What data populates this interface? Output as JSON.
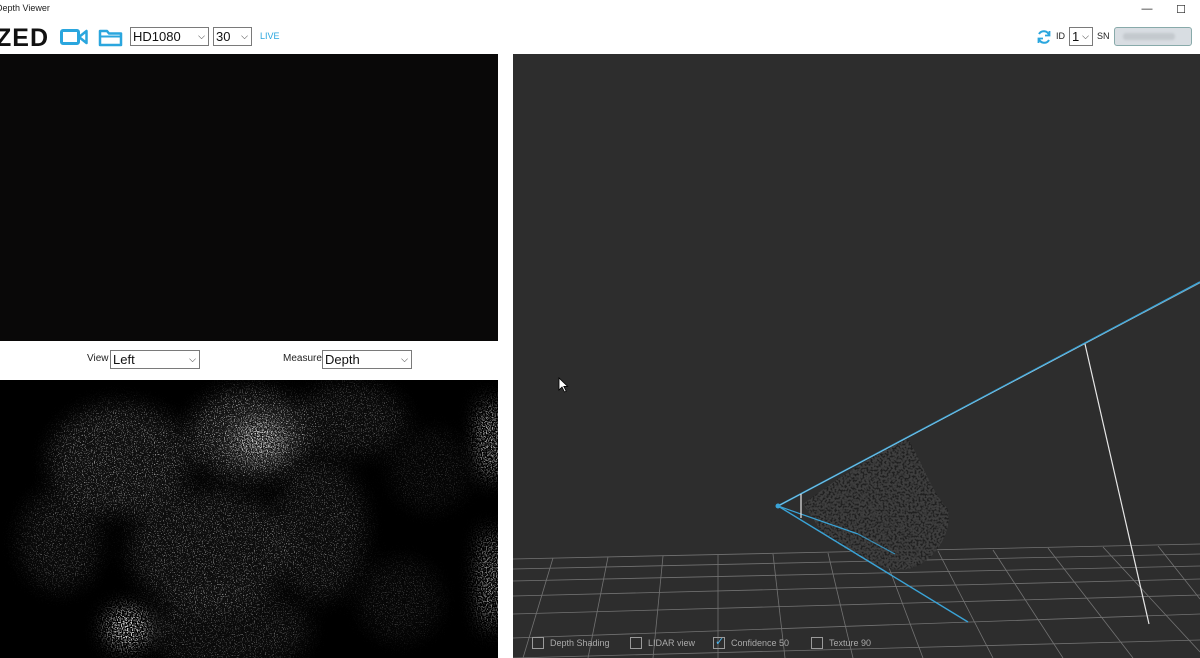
{
  "window": {
    "title": "Depth Viewer",
    "minimize_glyph": "—",
    "maximize_glyph": "☐"
  },
  "toolbar": {
    "logo": "ZED",
    "camera_icon": "video-camera-icon",
    "folder_icon": "folder-icon",
    "resolution": "HD1080",
    "fps": "30",
    "status": "LIVE",
    "refresh_icon": "refresh-icon",
    "id_label": "ID",
    "id_value": "1",
    "sn_label": "SN",
    "sn_value": ""
  },
  "left_panel": {
    "view_label": "View",
    "view_value": "Left",
    "measure_label": "Measure",
    "measure_value": "Depth"
  },
  "view3d": {
    "options": [
      {
        "label": "Depth Shading",
        "checked": false
      },
      {
        "label": "LIDAR view",
        "checked": false
      },
      {
        "label": "Confidence 50",
        "checked": true
      },
      {
        "label": "Texture 90",
        "checked": false
      }
    ]
  },
  "colors": {
    "accent": "#2aa6de",
    "viewport_bg": "#2d2d2d",
    "frustum": "#3aa3d6"
  }
}
